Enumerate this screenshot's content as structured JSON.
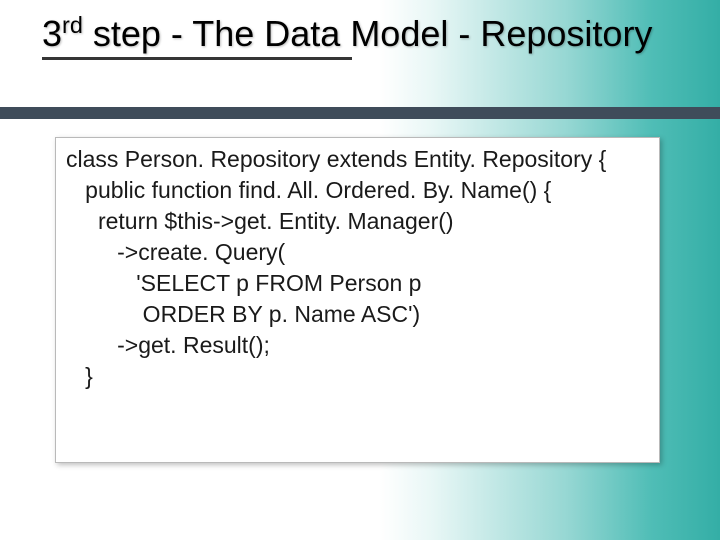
{
  "title": {
    "ord_num": "3",
    "ord_suffix": "rd",
    "rest": " step - The Data Model - Repository"
  },
  "code": {
    "lines": [
      "class Person. Repository extends Entity. Repository {",
      "   public function find. All. Ordered. By. Name() {",
      "     return $this->get. Entity. Manager()",
      "        ->create. Query(",
      "           'SELECT p FROM Person p",
      "            ORDER BY p. Name ASC')",
      "        ->get. Result();",
      "   }"
    ]
  }
}
